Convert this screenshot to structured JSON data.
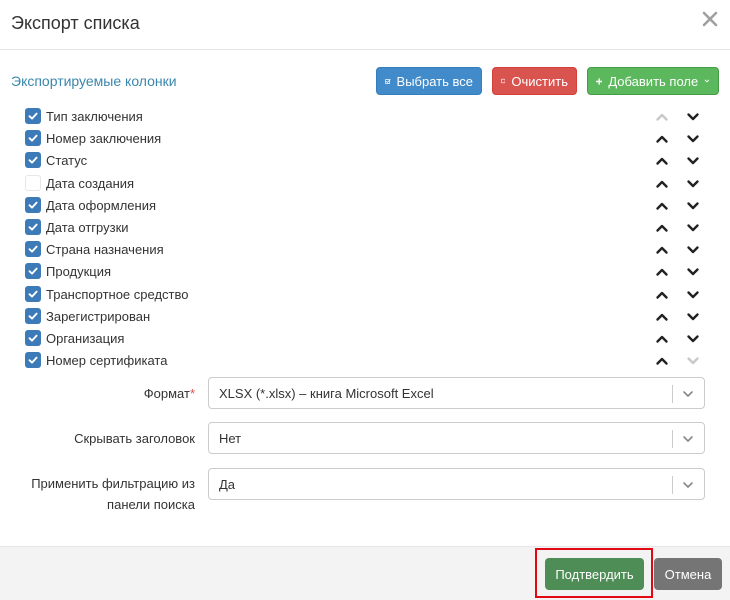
{
  "dialog": {
    "title": "Экспорт списка"
  },
  "columns_section": {
    "title": "Экспортируемые колонки",
    "select_all_label": "Выбрать все",
    "clear_label": "Очистить",
    "add_field_label": "Добавить поле"
  },
  "columns": [
    {
      "label": "Тип заключения",
      "checked": true
    },
    {
      "label": "Номер заключения",
      "checked": true
    },
    {
      "label": "Статус",
      "checked": true
    },
    {
      "label": "Дата создания",
      "checked": false
    },
    {
      "label": "Дата оформления",
      "checked": true
    },
    {
      "label": "Дата отгрузки",
      "checked": true
    },
    {
      "label": "Страна назначения",
      "checked": true
    },
    {
      "label": "Продукция",
      "checked": true
    },
    {
      "label": "Транспортное средство",
      "checked": true
    },
    {
      "label": "Зарегистрирован",
      "checked": true
    },
    {
      "label": "Организация",
      "checked": true
    },
    {
      "label": "Номер сертификата",
      "checked": true
    }
  ],
  "form": {
    "format_label": "Формат",
    "format_value": "XLSX (*.xlsx) – книга Microsoft Excel",
    "hide_header_label": "Скрывать заголовок",
    "hide_header_value": "Нет",
    "apply_filter_label_1": "Применить фильтрацию из",
    "apply_filter_label_2": "панели поиска",
    "apply_filter_value": "Да"
  },
  "footer": {
    "confirm_label": "Подтвердить",
    "cancel_label": "Отмена"
  },
  "colors": {
    "accent_link": "#3a87ad",
    "primary": "#428bca",
    "danger": "#d9534f",
    "success": "#5cb85c",
    "confirm": "#4e8d55",
    "highlight": "#e30613"
  }
}
